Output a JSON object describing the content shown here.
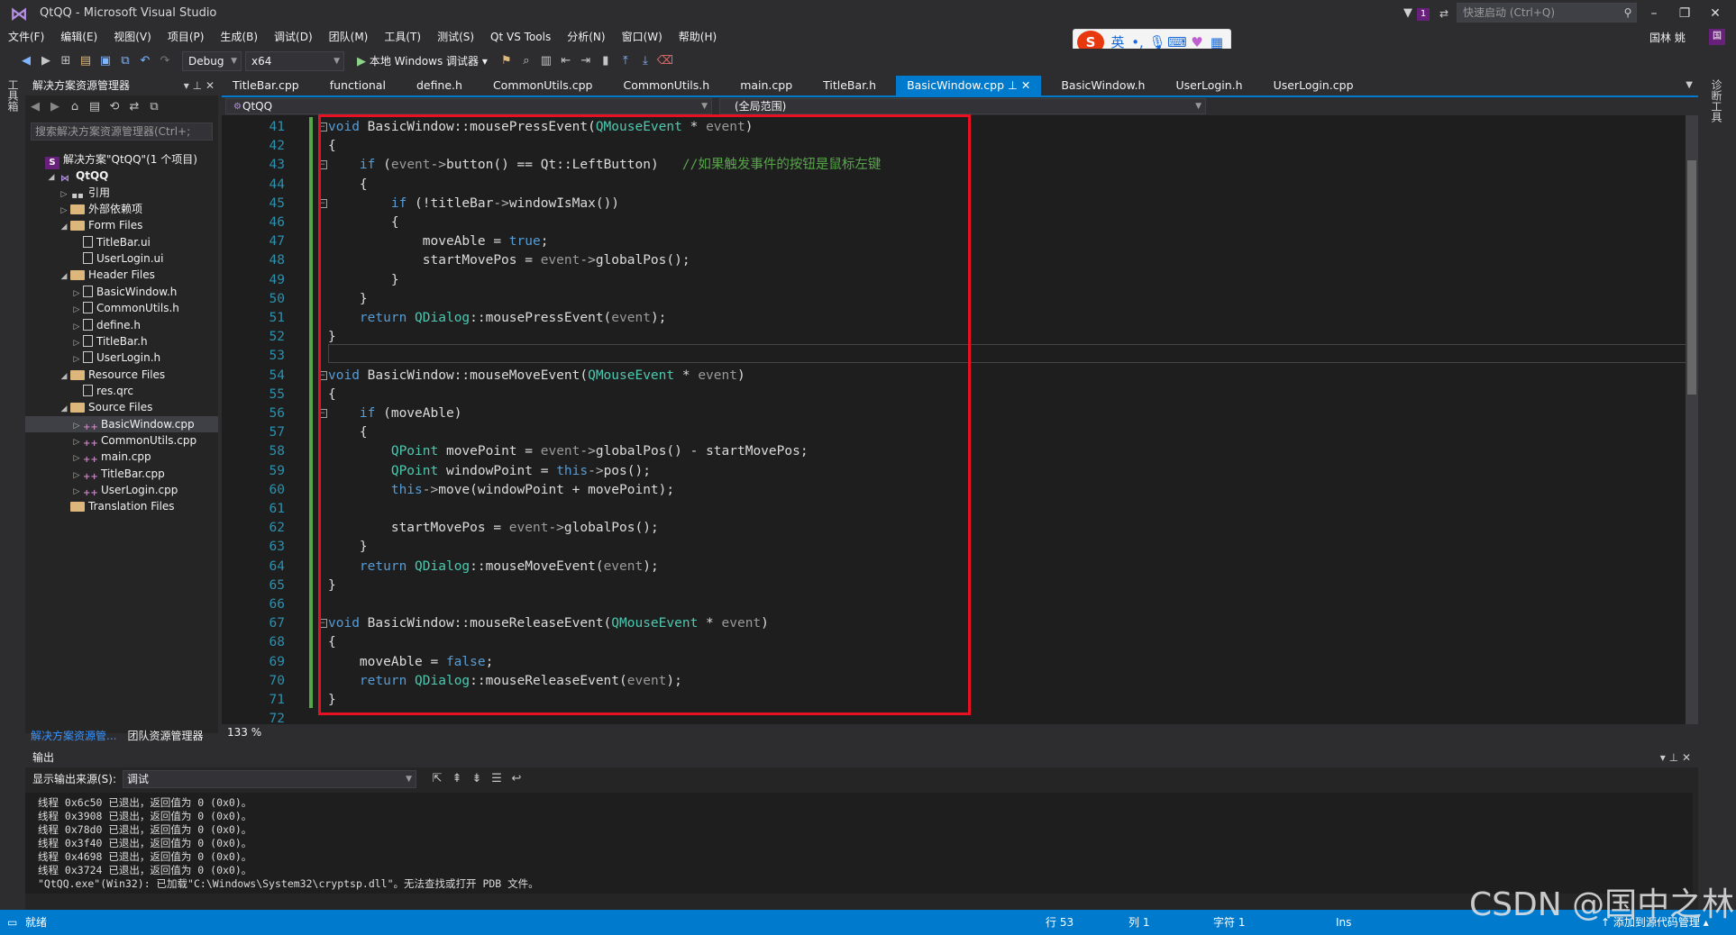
{
  "window": {
    "title": "QtQQ - Microsoft Visual Studio",
    "notification_count": "1",
    "quick_launch_placeholder": "快速启动 (Ctrl+Q)",
    "user": "国林 姚",
    "user_avatar": "国"
  },
  "ime": {
    "mode": "英",
    "punct": "•,"
  },
  "menu": [
    "文件(F)",
    "编辑(E)",
    "视图(V)",
    "项目(P)",
    "生成(B)",
    "调试(D)",
    "团队(M)",
    "工具(T)",
    "测试(S)",
    "Qt VS Tools",
    "分析(N)",
    "窗口(W)",
    "帮助(H)"
  ],
  "toolbar": {
    "config": "Debug",
    "platform": "x64",
    "run_label": "本地 Windows 调试器"
  },
  "left_strip": "工具箱",
  "right_strip": "诊断工具",
  "solution_explorer": {
    "title": "解决方案资源管理器",
    "search_placeholder": "搜索解决方案资源管理器(Ctrl+;",
    "tree": [
      {
        "label": "解决方案\"QtQQ\"(1 个项目)",
        "kind": "sol",
        "level": 0,
        "twist": ""
      },
      {
        "label": "QtQQ",
        "kind": "proj",
        "level": 1,
        "twist": "◢"
      },
      {
        "label": "引用",
        "kind": "ref",
        "level": 2,
        "twist": "▷"
      },
      {
        "label": "外部依赖项",
        "kind": "folder",
        "level": 2,
        "twist": "▷"
      },
      {
        "label": "Form Files",
        "kind": "folder",
        "level": 2,
        "twist": "◢"
      },
      {
        "label": "TitleBar.ui",
        "kind": "file",
        "level": 3,
        "twist": ""
      },
      {
        "label": "UserLogin.ui",
        "kind": "file",
        "level": 3,
        "twist": ""
      },
      {
        "label": "Header Files",
        "kind": "folder",
        "level": 2,
        "twist": "◢"
      },
      {
        "label": "BasicWindow.h",
        "kind": "file",
        "level": 3,
        "twist": "▷"
      },
      {
        "label": "CommonUtils.h",
        "kind": "file",
        "level": 3,
        "twist": "▷"
      },
      {
        "label": "define.h",
        "kind": "file",
        "level": 3,
        "twist": "▷"
      },
      {
        "label": "TitleBar.h",
        "kind": "file",
        "level": 3,
        "twist": "▷"
      },
      {
        "label": "UserLogin.h",
        "kind": "file",
        "level": 3,
        "twist": "▷"
      },
      {
        "label": "Resource Files",
        "kind": "folder",
        "level": 2,
        "twist": "◢"
      },
      {
        "label": "res.qrc",
        "kind": "file",
        "level": 3,
        "twist": ""
      },
      {
        "label": "Source Files",
        "kind": "folder",
        "level": 2,
        "twist": "◢"
      },
      {
        "label": "BasicWindow.cpp",
        "kind": "cpp",
        "level": 3,
        "twist": "▷",
        "selected": true
      },
      {
        "label": "CommonUtils.cpp",
        "kind": "cpp",
        "level": 3,
        "twist": "▷"
      },
      {
        "label": "main.cpp",
        "kind": "cpp",
        "level": 3,
        "twist": "▷"
      },
      {
        "label": "TitleBar.cpp",
        "kind": "cpp",
        "level": 3,
        "twist": "▷"
      },
      {
        "label": "UserLogin.cpp",
        "kind": "cpp",
        "level": 3,
        "twist": "▷"
      },
      {
        "label": "Translation Files",
        "kind": "folder",
        "level": 2,
        "twist": ""
      }
    ],
    "bottom_tabs": [
      "解决方案资源管...",
      "团队资源管理器"
    ]
  },
  "editor": {
    "tabs": [
      "TitleBar.cpp",
      "functional",
      "define.h",
      "CommonUtils.cpp",
      "CommonUtils.h",
      "main.cpp",
      "TitleBar.h",
      "BasicWindow.cpp",
      "BasicWindow.h",
      "UserLogin.h",
      "UserLogin.cpp"
    ],
    "active_tab": "BasicWindow.cpp",
    "nav_project": "QtQQ",
    "nav_scope": "(全局范围)",
    "zoom": "133 %",
    "lines": [
      {
        "n": "41",
        "tokens": [
          [
            "kw",
            "void"
          ],
          [
            "t",
            " BasicWindow::mousePressEvent("
          ],
          [
            "ty",
            "QMouseEvent"
          ],
          [
            "t",
            " * "
          ],
          [
            "pm",
            "event"
          ],
          [
            "t",
            ")"
          ]
        ],
        "fold": "⊟"
      },
      {
        "n": "42",
        "tokens": [
          [
            "t",
            "{"
          ]
        ]
      },
      {
        "n": "43",
        "tokens": [
          [
            "t",
            "    "
          ],
          [
            "kw",
            "if"
          ],
          [
            "t",
            " ("
          ],
          [
            "pm",
            "event"
          ],
          [
            "op",
            "->"
          ],
          [
            "t",
            "button() == Qt::LeftButton)   "
          ],
          [
            "cm",
            "//如果触发事件的按钮是鼠标左键"
          ]
        ],
        "fold": "⊟"
      },
      {
        "n": "44",
        "tokens": [
          [
            "t",
            "    {"
          ]
        ]
      },
      {
        "n": "45",
        "tokens": [
          [
            "t",
            "        "
          ],
          [
            "kw",
            "if"
          ],
          [
            "t",
            " (!titleBar"
          ],
          [
            "op",
            "->"
          ],
          [
            "t",
            "windowIsMax())"
          ]
        ],
        "fold": "⊟"
      },
      {
        "n": "46",
        "tokens": [
          [
            "t",
            "        {"
          ]
        ]
      },
      {
        "n": "47",
        "tokens": [
          [
            "t",
            "            moveAble = "
          ],
          [
            "kw",
            "true"
          ],
          [
            "t",
            ";"
          ]
        ]
      },
      {
        "n": "48",
        "tokens": [
          [
            "t",
            "            startMovePos = "
          ],
          [
            "pm",
            "event"
          ],
          [
            "op",
            "->"
          ],
          [
            "t",
            "globalPos();"
          ]
        ]
      },
      {
        "n": "49",
        "tokens": [
          [
            "t",
            "        }"
          ]
        ]
      },
      {
        "n": "50",
        "tokens": [
          [
            "t",
            "    }"
          ]
        ]
      },
      {
        "n": "51",
        "tokens": [
          [
            "t",
            "    "
          ],
          [
            "kw",
            "return"
          ],
          [
            "t",
            " "
          ],
          [
            "ty",
            "QDialog"
          ],
          [
            "t",
            "::mousePressEvent("
          ],
          [
            "pm",
            "event"
          ],
          [
            "t",
            ");"
          ]
        ]
      },
      {
        "n": "52",
        "tokens": [
          [
            "t",
            "}"
          ]
        ]
      },
      {
        "n": "53",
        "tokens": [
          [
            "t",
            ""
          ]
        ]
      },
      {
        "n": "54",
        "tokens": [
          [
            "kw",
            "void"
          ],
          [
            "t",
            " BasicWindow::mouseMoveEvent("
          ],
          [
            "ty",
            "QMouseEvent"
          ],
          [
            "t",
            " * "
          ],
          [
            "pm",
            "event"
          ],
          [
            "t",
            ")"
          ]
        ],
        "fold": "⊟"
      },
      {
        "n": "55",
        "tokens": [
          [
            "t",
            "{"
          ]
        ]
      },
      {
        "n": "56",
        "tokens": [
          [
            "t",
            "    "
          ],
          [
            "kw",
            "if"
          ],
          [
            "t",
            " (moveAble)"
          ]
        ],
        "fold": "⊟"
      },
      {
        "n": "57",
        "tokens": [
          [
            "t",
            "    {"
          ]
        ]
      },
      {
        "n": "58",
        "tokens": [
          [
            "t",
            "        "
          ],
          [
            "ty",
            "QPoint"
          ],
          [
            "t",
            " movePoint = "
          ],
          [
            "pm",
            "event"
          ],
          [
            "op",
            "->"
          ],
          [
            "t",
            "globalPos() - startMovePos;"
          ]
        ]
      },
      {
        "n": "59",
        "tokens": [
          [
            "t",
            "        "
          ],
          [
            "ty",
            "QPoint"
          ],
          [
            "t",
            " windowPoint = "
          ],
          [
            "kw",
            "this"
          ],
          [
            "op",
            "->"
          ],
          [
            "t",
            "pos();"
          ]
        ]
      },
      {
        "n": "60",
        "tokens": [
          [
            "t",
            "        "
          ],
          [
            "kw",
            "this"
          ],
          [
            "op",
            "->"
          ],
          [
            "t",
            "move(windowPoint + movePoint);"
          ]
        ]
      },
      {
        "n": "61",
        "tokens": [
          [
            "t",
            ""
          ]
        ]
      },
      {
        "n": "62",
        "tokens": [
          [
            "t",
            "        startMovePos = "
          ],
          [
            "pm",
            "event"
          ],
          [
            "op",
            "->"
          ],
          [
            "t",
            "globalPos();"
          ]
        ]
      },
      {
        "n": "63",
        "tokens": [
          [
            "t",
            "    }"
          ]
        ]
      },
      {
        "n": "64",
        "tokens": [
          [
            "t",
            "    "
          ],
          [
            "kw",
            "return"
          ],
          [
            "t",
            " "
          ],
          [
            "ty",
            "QDialog"
          ],
          [
            "t",
            "::mouseMoveEvent("
          ],
          [
            "pm",
            "event"
          ],
          [
            "t",
            ");"
          ]
        ]
      },
      {
        "n": "65",
        "tokens": [
          [
            "t",
            "}"
          ]
        ]
      },
      {
        "n": "66",
        "tokens": [
          [
            "t",
            ""
          ]
        ]
      },
      {
        "n": "67",
        "tokens": [
          [
            "kw",
            "void"
          ],
          [
            "t",
            " BasicWindow::mouseReleaseEvent("
          ],
          [
            "ty",
            "QMouseEvent"
          ],
          [
            "t",
            " * "
          ],
          [
            "pm",
            "event"
          ],
          [
            "t",
            ")"
          ]
        ],
        "fold": "⊟"
      },
      {
        "n": "68",
        "tokens": [
          [
            "t",
            "{"
          ]
        ]
      },
      {
        "n": "69",
        "tokens": [
          [
            "t",
            "    moveAble = "
          ],
          [
            "kw",
            "false"
          ],
          [
            "t",
            ";"
          ]
        ]
      },
      {
        "n": "70",
        "tokens": [
          [
            "t",
            "    "
          ],
          [
            "kw",
            "return"
          ],
          [
            "t",
            " "
          ],
          [
            "ty",
            "QDialog"
          ],
          [
            "t",
            "::mouseReleaseEvent("
          ],
          [
            "pm",
            "event"
          ],
          [
            "t",
            ");"
          ]
        ]
      },
      {
        "n": "71",
        "tokens": [
          [
            "t",
            "}"
          ]
        ]
      },
      {
        "n": "72",
        "tokens": [
          [
            "t",
            ""
          ]
        ]
      }
    ]
  },
  "output": {
    "title": "输出",
    "source_label": "显示输出来源(S):",
    "source_value": "调试",
    "lines": [
      "线程 0x6c50 已退出，返回值为 0 (0x0)。",
      "线程 0x3908 已退出，返回值为 0 (0x0)。",
      "线程 0x78d0 已退出，返回值为 0 (0x0)。",
      "线程 0x3f40 已退出，返回值为 0 (0x0)。",
      "线程 0x4698 已退出，返回值为 0 (0x0)。",
      "线程 0x3724 已退出，返回值为 0 (0x0)。",
      "\"QtQQ.exe\"(Win32): 已加载\"C:\\Windows\\System32\\cryptsp.dll\"。无法查找或打开 PDB 文件。"
    ]
  },
  "status": {
    "ready": "就绪",
    "line": "行 53",
    "col": "列 1",
    "char": "字符 1",
    "mode": "Ins",
    "source_control": "↑ 添加到源代码管理 ▴"
  },
  "watermark": "CSDN @国中之林",
  "colors": {
    "accent": "#007acc",
    "highlight_box": "#e81123",
    "keyword": "#569cd6",
    "type": "#4ec9b0",
    "comment": "#57a64a"
  }
}
